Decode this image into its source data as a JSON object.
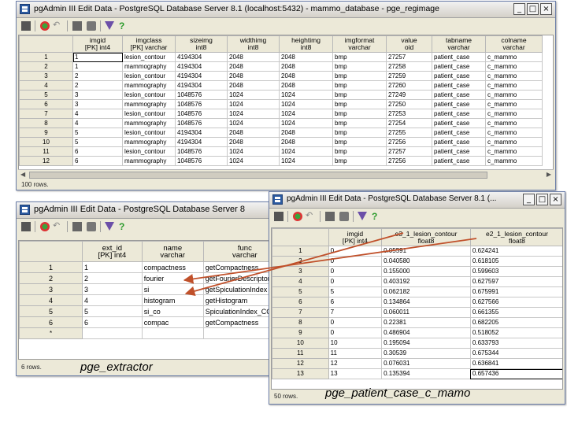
{
  "colors": {
    "arrow": "#c0502a",
    "accent": "#2c5aa0"
  },
  "window1": {
    "title": "pgAdmin III Edit Data - PostgreSQL Database Server 8.1 (localhost:5432) - mammo_database - pge_regimage",
    "columns": [
      {
        "name": "imgid",
        "type": "[PK] int4"
      },
      {
        "name": "imgclass",
        "type": "[PK] varchar"
      },
      {
        "name": "sizeimg",
        "type": "int8"
      },
      {
        "name": "widthimg",
        "type": "int8"
      },
      {
        "name": "heightimg",
        "type": "int8"
      },
      {
        "name": "imgformat",
        "type": "varchar"
      },
      {
        "name": "value",
        "type": "oid"
      },
      {
        "name": "tabname",
        "type": "varchar"
      },
      {
        "name": "colname",
        "type": "varchar"
      }
    ],
    "rows": [
      [
        "1",
        "1",
        "lesion_contour",
        "4194304",
        "2048",
        "2048",
        "bmp",
        "27257",
        "patient_case",
        "c_mammo"
      ],
      [
        "2",
        "1",
        "mammography",
        "4194304",
        "2048",
        "2048",
        "bmp",
        "27258",
        "patient_case",
        "c_mammo"
      ],
      [
        "3",
        "2",
        "lesion_contour",
        "4194304",
        "2048",
        "2048",
        "bmp",
        "27259",
        "patient_case",
        "c_mammo"
      ],
      [
        "4",
        "2",
        "mammography",
        "4194304",
        "2048",
        "2048",
        "bmp",
        "27260",
        "patient_case",
        "c_mammo"
      ],
      [
        "5",
        "3",
        "lesion_contour",
        "1048576",
        "1024",
        "1024",
        "bmp",
        "27249",
        "patient_case",
        "c_mammo"
      ],
      [
        "6",
        "3",
        "mammography",
        "1048576",
        "1024",
        "1024",
        "bmp",
        "27250",
        "patient_case",
        "c_mammo"
      ],
      [
        "7",
        "4",
        "lesion_contour",
        "1048576",
        "1024",
        "1024",
        "bmp",
        "27253",
        "patient_case",
        "c_mammo"
      ],
      [
        "8",
        "4",
        "mammography",
        "1048576",
        "1024",
        "1024",
        "bmp",
        "27254",
        "patient_case",
        "c_mammo"
      ],
      [
        "9",
        "5",
        "lesion_contour",
        "4194304",
        "2048",
        "2048",
        "bmp",
        "27255",
        "patient_case",
        "c_mammo"
      ],
      [
        "10",
        "5",
        "mammography",
        "4194304",
        "2048",
        "2048",
        "bmp",
        "27256",
        "patient_case",
        "c_mammo"
      ],
      [
        "11",
        "6",
        "lesion_contour",
        "1048576",
        "1024",
        "1024",
        "bmp",
        "27257",
        "patient_case",
        "c_mammo"
      ],
      [
        "12",
        "6",
        "mammography",
        "1048576",
        "1024",
        "1024",
        "bmp",
        "27256",
        "patient_case",
        "c_mammo"
      ]
    ],
    "status": "100 rows."
  },
  "window2": {
    "title": "pgAdmin III Edit Data - PostgreSQL Database Server 8",
    "columns": [
      {
        "name": "ext_id",
        "type": "[PK] int4"
      },
      {
        "name": "name",
        "type": "varchar"
      },
      {
        "name": "func",
        "type": "varchar"
      }
    ],
    "rows": [
      [
        "1",
        "1",
        "compactness",
        "getCompactness"
      ],
      [
        "2",
        "2",
        "fourier",
        "getFourierDescriptor"
      ],
      [
        "3",
        "3",
        "si",
        "getSpiculationIndex"
      ],
      [
        "4",
        "4",
        "histogram",
        "getHistogram"
      ],
      [
        "5",
        "5",
        "si_co",
        "SpiculationIndex_CO"
      ],
      [
        "6",
        "6",
        "compac",
        "getCompactness"
      ]
    ],
    "new_row_marker": "*",
    "status": "6 rows.",
    "caption": "pge_extractor"
  },
  "window3": {
    "title": "pgAdmin III Edit Data - PostgreSQL Database Server 8.1 (...",
    "columns": [
      {
        "name": "imgid",
        "type": "[PK] int4"
      },
      {
        "name": "e3_1_lesion_contour",
        "type": "float8"
      },
      {
        "name": "e2_1_lesion_contour",
        "type": "float8"
      }
    ],
    "rows": [
      [
        "1",
        "0",
        "0.05591",
        "0.624241"
      ],
      [
        "2",
        "0",
        "0.040580",
        "0.618105"
      ],
      [
        "3",
        "0",
        "0.155000",
        "0.599603"
      ],
      [
        "4",
        "0",
        "0.403192",
        "0.627597"
      ],
      [
        "5",
        "5",
        "0.062182",
        "0.675991"
      ],
      [
        "6",
        "6",
        "0.134864",
        "0.627566"
      ],
      [
        "7",
        "7",
        "0.060011",
        "0.661355"
      ],
      [
        "8",
        "0",
        "0.22381",
        "0.682205"
      ],
      [
        "9",
        "0",
        "0.486904",
        "0.518052"
      ],
      [
        "10",
        "10",
        "0.195094",
        "0.633793"
      ],
      [
        "11",
        "11",
        "0.30539",
        "0.675344"
      ],
      [
        "12",
        "12",
        "0.076031",
        "0.636841"
      ],
      [
        "13",
        "13",
        "0.135394",
        "0.657436"
      ]
    ],
    "status": "50 rows.",
    "caption": "pge_patient_case_c_mamo"
  },
  "icons": [
    "save-icon",
    "refresh-icon",
    "undo-icon",
    "copy-icon",
    "paste-icon",
    "filter-icon",
    "help-icon"
  ]
}
